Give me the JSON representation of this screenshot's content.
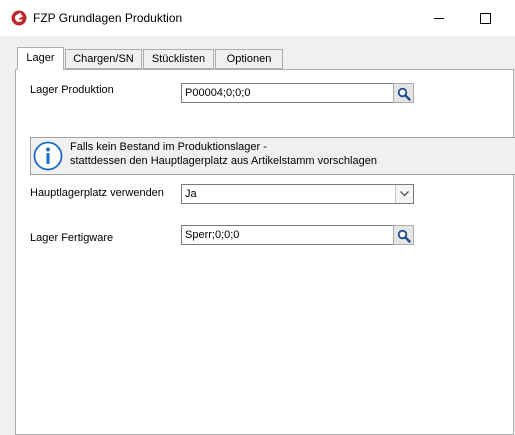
{
  "window": {
    "title": "FZP Grundlagen Produktion",
    "icon": "app-logo-icon",
    "minimize_glyph": "minimize-icon",
    "maximize_glyph": "maximize-icon"
  },
  "tabs": [
    {
      "label": "Lager",
      "active": true
    },
    {
      "label": "Chargen/SN",
      "active": false
    },
    {
      "label": "Stücklisten",
      "active": false
    },
    {
      "label": "Optionen",
      "active": false
    }
  ],
  "lager": {
    "lager_produktion": {
      "label": "Lager Produktion",
      "value": "P00004;0;0;0"
    },
    "info": {
      "line1": "Falls kein Bestand im Produktionslager -",
      "line2": "stattdessen den Hauptlagerplatz aus Artikelstamm vorschlagen",
      "icon": "info-icon"
    },
    "hauptlagerplatz": {
      "label": "Hauptlagerplatz verwenden",
      "value": "Ja"
    },
    "lager_fertigware": {
      "label": "Lager Fertigware",
      "value": "Sperr;0;0;0"
    }
  },
  "colors": {
    "accent_red": "#c0262d",
    "info_blue": "#1e6fc4",
    "panel_bg": "#f0f0f0"
  }
}
